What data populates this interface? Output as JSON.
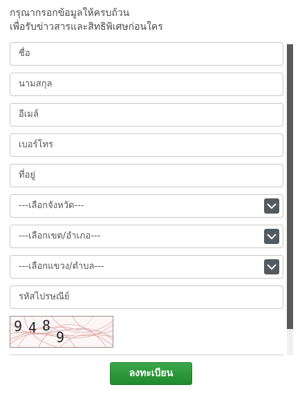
{
  "intro": {
    "line1": "กรุณากรอกข้อมูลให้ครบถ้วน",
    "line2": "เพื่อรับข่าวสารและสิทธิพิเศษก่อนใคร"
  },
  "form": {
    "name_placeholder": "ชื่อ",
    "lastname_placeholder": "นามสกุล",
    "email_placeholder": "อีเมล์",
    "phone_placeholder": "เบอร์โทร",
    "address_placeholder": "ที่อยู่",
    "province_select": "---เลือกจังหวัด---",
    "district_select": "---เลือกเขต/อำเภอ---",
    "subdistrict_select": "---เลือกแขวง/ตำบล---",
    "postcode_placeholder": "รหัสไปรษณีย์"
  },
  "captcha": {
    "d1": "9",
    "d2": "4",
    "d3": "8",
    "d4": "9"
  },
  "submit_label": "ลงทะเบียน",
  "colors": {
    "button_green": "#2b9a3b",
    "select_arrow_bg": "#555a5f"
  }
}
